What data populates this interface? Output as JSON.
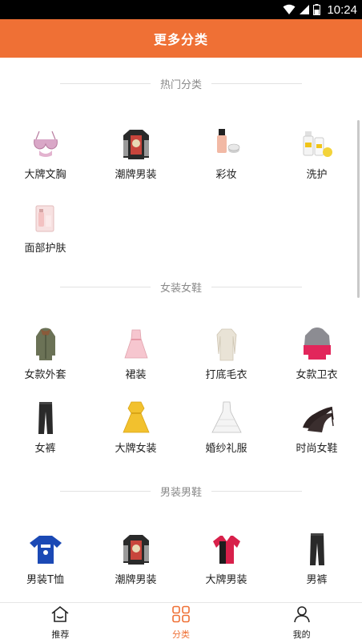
{
  "status_bar": {
    "time": "10:24"
  },
  "header": {
    "title": "更多分类"
  },
  "sections": [
    {
      "title": "热门分类",
      "items": [
        {
          "label": "大牌文胸",
          "icon": "bra-icon"
        },
        {
          "label": "潮牌男装",
          "icon": "jacket-icon"
        },
        {
          "label": "彩妆",
          "icon": "cosmetics-icon"
        },
        {
          "label": "洗护",
          "icon": "skincare-bottles-icon"
        },
        {
          "label": "面部护肤",
          "icon": "face-care-icon"
        }
      ]
    },
    {
      "title": "女装女鞋",
      "items": [
        {
          "label": "女款外套",
          "icon": "coat-icon"
        },
        {
          "label": "裙装",
          "icon": "dress-icon"
        },
        {
          "label": "打底毛衣",
          "icon": "sweater-dress-icon"
        },
        {
          "label": "女款卫衣",
          "icon": "hoodie-icon"
        },
        {
          "label": "女裤",
          "icon": "pants-icon"
        },
        {
          "label": "大牌女装",
          "icon": "yellow-dress-icon"
        },
        {
          "label": "婚纱礼服",
          "icon": "wedding-dress-icon"
        },
        {
          "label": "时尚女鞋",
          "icon": "high-heels-icon"
        }
      ]
    },
    {
      "title": "男装男鞋",
      "items": [
        {
          "label": "男装T恤",
          "icon": "tshirt-icon"
        },
        {
          "label": "潮牌男装",
          "icon": "jacket-icon"
        },
        {
          "label": "大牌男装",
          "icon": "polo-shirt-icon"
        },
        {
          "label": "男裤",
          "icon": "pants-icon"
        }
      ]
    }
  ],
  "tabbar": {
    "tabs": [
      {
        "label": "推荐",
        "icon": "home-icon",
        "active": false
      },
      {
        "label": "分类",
        "icon": "category-grid-icon",
        "active": true
      },
      {
        "label": "我的",
        "icon": "user-icon",
        "active": false
      }
    ]
  },
  "colors": {
    "accent": "#ef7035"
  }
}
